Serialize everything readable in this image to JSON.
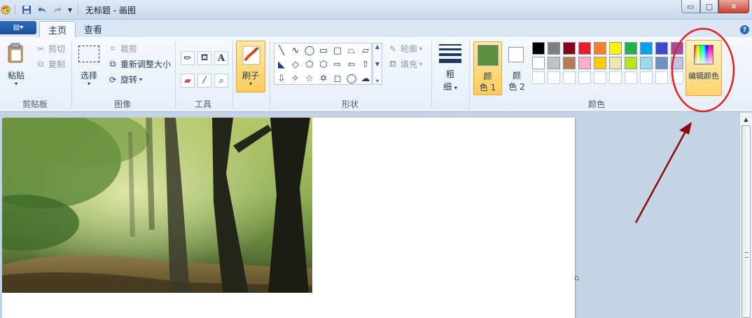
{
  "window": {
    "title": "无标题 - 画图",
    "minimize_label": "▭",
    "maximize_label": "▢",
    "close_label": "✕"
  },
  "tabs": [
    {
      "label": "主页",
      "active": true
    },
    {
      "label": "查看",
      "active": false
    }
  ],
  "file_button": {
    "label": "▤▾"
  },
  "help_label": "?",
  "clipboard": {
    "paste_label": "粘贴",
    "cut_label": "剪切",
    "copy_label": "复制",
    "group_label": "剪贴板"
  },
  "image_group": {
    "select_label": "选择",
    "crop_label": "裁剪",
    "resize_label": "重新调整大小",
    "rotate_label": "旋转",
    "group_label": "图像"
  },
  "tools_group": {
    "group_label": "工具",
    "text_tool": "A"
  },
  "brush": {
    "label": "刷子"
  },
  "shapes_group": {
    "outline_label": "轮廓",
    "fill_label": "填充",
    "group_label": "形状",
    "shapes": [
      "╲",
      "∿",
      "◯",
      "▭",
      "▢",
      "⏢",
      "⏥",
      "◣",
      "◇",
      "⬠",
      "⬡",
      "⇨",
      "⇦",
      "⇧",
      "⇩",
      "✧",
      "☆",
      "✡",
      "◻",
      "◯",
      "☁"
    ]
  },
  "size": {
    "label_top": "粗",
    "label_bottom": "细"
  },
  "colors_group": {
    "color1_top": "颜",
    "color1_bottom": "色 1",
    "color2_top": "颜",
    "color2_bottom": "色 2",
    "color1_value": "#5b8e3f",
    "color2_value": "#ffffff",
    "group_label": "颜色",
    "palette_row1": [
      "#000000",
      "#7f7f7f",
      "#880015",
      "#ed1c24",
      "#ff7f27",
      "#fff200",
      "#22b14c",
      "#00a2e8",
      "#3f48cc",
      "#a349a4"
    ],
    "palette_row2": [
      "#ffffff",
      "#c3c3c3",
      "#b97a57",
      "#ffaec9",
      "#ffc90e",
      "#efe4b0",
      "#b5e61d",
      "#99d9ea",
      "#7092be",
      "#c8bfe7"
    ],
    "edit_label": "编辑颜色"
  },
  "annotation": {
    "color": "#e02020",
    "arrow_color": "#8b0a0a"
  }
}
